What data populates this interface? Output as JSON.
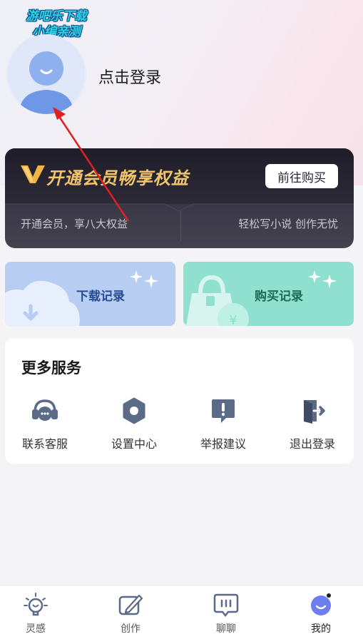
{
  "watermark": {
    "line1": "游吧乐下载",
    "line2": "小编亲测"
  },
  "profile": {
    "login_text": "点击登录"
  },
  "vip": {
    "title": "开通会员畅享权益",
    "button": "前往购买",
    "left_text": "开通会员，享八大权益",
    "right_text": "轻松写小说 创作无忧"
  },
  "records": {
    "download": "下载记录",
    "purchase": "购买记录"
  },
  "services": {
    "title": "更多服务",
    "items": [
      {
        "label": "联系客服",
        "icon": "headset-icon"
      },
      {
        "label": "设置中心",
        "icon": "settings-icon"
      },
      {
        "label": "举报建议",
        "icon": "report-icon"
      },
      {
        "label": "退出登录",
        "icon": "logout-icon"
      }
    ]
  },
  "tabs": [
    {
      "label": "灵感",
      "icon": "lightbulb-icon"
    },
    {
      "label": "创作",
      "icon": "pen-icon"
    },
    {
      "label": "聊聊",
      "icon": "chat-icon"
    },
    {
      "label": "我的",
      "icon": "profile-icon"
    }
  ],
  "colors": {
    "accent": "#6d7ef0",
    "vip_gold": "#f2c56a",
    "download_bg": "#b7cdf1",
    "purchase_bg": "#90e0cf",
    "arrow": "#e02020"
  }
}
